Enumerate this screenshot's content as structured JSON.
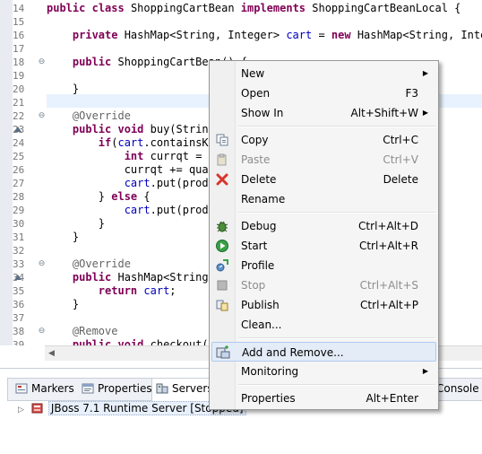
{
  "editor": {
    "lines": [
      {
        "num": "14",
        "segments": [
          {
            "t": "public",
            "k": "kw"
          },
          {
            "t": " "
          },
          {
            "t": "class",
            "k": "kw"
          },
          {
            "t": " ShoppingCartBean "
          },
          {
            "t": "implements",
            "k": "kw"
          },
          {
            "t": " ShoppingCartBeanLocal {"
          }
        ]
      },
      {
        "num": "15",
        "segments": []
      },
      {
        "num": "16",
        "segments": [
          {
            "t": "    "
          },
          {
            "t": "private",
            "k": "kw"
          },
          {
            "t": " HashMap<String, Integer> "
          },
          {
            "t": "cart",
            "k": "fld"
          },
          {
            "t": " = "
          },
          {
            "t": "new",
            "k": "kw"
          },
          {
            "t": " HashMap<String, Intege"
          }
        ]
      },
      {
        "num": "17",
        "segments": []
      },
      {
        "num": "18",
        "segments": [
          {
            "t": "    "
          },
          {
            "t": "public",
            "k": "kw"
          },
          {
            "t": " ShoppingCartBean() {"
          }
        ]
      },
      {
        "num": "19",
        "segments": []
      },
      {
        "num": "20",
        "segments": [
          {
            "t": "    }"
          }
        ]
      },
      {
        "num": "21",
        "segments": []
      },
      {
        "num": "22",
        "segments": [
          {
            "t": "    "
          },
          {
            "t": "@Override",
            "k": "ann"
          }
        ]
      },
      {
        "num": "23",
        "segments": [
          {
            "t": "    "
          },
          {
            "t": "public",
            "k": "kw"
          },
          {
            "t": " "
          },
          {
            "t": "void",
            "k": "kw"
          },
          {
            "t": " buy(String"
          }
        ]
      },
      {
        "num": "24",
        "segments": [
          {
            "t": "        "
          },
          {
            "t": "if",
            "k": "kw"
          },
          {
            "t": "("
          },
          {
            "t": "cart",
            "k": "fld"
          },
          {
            "t": ".containsKe"
          }
        ]
      },
      {
        "num": "25",
        "segments": [
          {
            "t": "            "
          },
          {
            "t": "int",
            "k": "kw"
          },
          {
            "t": " currqt = c"
          }
        ]
      },
      {
        "num": "26",
        "segments": [
          {
            "t": "            currqt += qual"
          }
        ]
      },
      {
        "num": "27",
        "segments": [
          {
            "t": "            "
          },
          {
            "t": "cart",
            "k": "fld"
          },
          {
            "t": ".put(produ"
          }
        ]
      },
      {
        "num": "28",
        "segments": [
          {
            "t": "        } "
          },
          {
            "t": "else",
            "k": "kw"
          },
          {
            "t": " {"
          }
        ]
      },
      {
        "num": "29",
        "segments": [
          {
            "t": "            "
          },
          {
            "t": "cart",
            "k": "fld"
          },
          {
            "t": ".put(produ"
          }
        ]
      },
      {
        "num": "30",
        "segments": [
          {
            "t": "        }"
          }
        ]
      },
      {
        "num": "31",
        "segments": [
          {
            "t": "    }"
          }
        ]
      },
      {
        "num": "32",
        "segments": []
      },
      {
        "num": "33",
        "segments": [
          {
            "t": "    "
          },
          {
            "t": "@Override",
            "k": "ann"
          }
        ]
      },
      {
        "num": "34",
        "segments": [
          {
            "t": "    "
          },
          {
            "t": "public",
            "k": "kw"
          },
          {
            "t": " HashMap<String,"
          }
        ]
      },
      {
        "num": "35",
        "segments": [
          {
            "t": "        "
          },
          {
            "t": "return",
            "k": "kw"
          },
          {
            "t": " "
          },
          {
            "t": "cart",
            "k": "fld"
          },
          {
            "t": ";"
          }
        ]
      },
      {
        "num": "36",
        "segments": [
          {
            "t": "    }"
          }
        ]
      },
      {
        "num": "37",
        "segments": []
      },
      {
        "num": "38",
        "segments": [
          {
            "t": "    "
          },
          {
            "t": "@Remove",
            "k": "ann"
          }
        ]
      },
      {
        "num": "39",
        "segments": [
          {
            "t": "    "
          },
          {
            "t": "public",
            "k": "kw"
          },
          {
            "t": " "
          },
          {
            "t": "void",
            "k": "kw"
          },
          {
            "t": " checkout()"
          }
        ]
      }
    ],
    "fold_markers": [
      "18",
      "22",
      "33",
      "38"
    ],
    "override_markers": [
      "23",
      "34"
    ]
  },
  "views": {
    "tabs": [
      {
        "name": "markers",
        "label": "Markers",
        "icon": "markers-icon"
      },
      {
        "name": "properties",
        "label": "Properties",
        "icon": "properties-icon"
      },
      {
        "name": "servers",
        "label": "Servers",
        "icon": "servers-icon",
        "active": true
      },
      {
        "name": "console",
        "label": "Console",
        "icon": "console-icon"
      }
    ],
    "server_entry": "JBoss 7.1 Runtime Server  [Stopped]"
  },
  "menu": {
    "items": [
      {
        "id": "new",
        "label": "New",
        "shortcut": "",
        "submenu": true,
        "disabled": false,
        "icon": ""
      },
      {
        "id": "open",
        "label": "Open",
        "shortcut": "F3",
        "submenu": false,
        "disabled": false,
        "icon": ""
      },
      {
        "id": "show-in",
        "label": "Show In",
        "shortcut": "Alt+Shift+W",
        "submenu": true,
        "disabled": false,
        "icon": ""
      },
      {
        "sep": true
      },
      {
        "id": "copy",
        "label": "Copy",
        "shortcut": "Ctrl+C",
        "submenu": false,
        "disabled": false,
        "icon": "copy-icon"
      },
      {
        "id": "paste",
        "label": "Paste",
        "shortcut": "Ctrl+V",
        "submenu": false,
        "disabled": true,
        "icon": "paste-icon"
      },
      {
        "id": "delete",
        "label": "Delete",
        "shortcut": "Delete",
        "submenu": false,
        "disabled": false,
        "icon": "delete-icon"
      },
      {
        "id": "rename",
        "label": "Rename",
        "shortcut": "",
        "submenu": false,
        "disabled": false,
        "icon": ""
      },
      {
        "sep": true
      },
      {
        "id": "debug",
        "label": "Debug",
        "shortcut": "Ctrl+Alt+D",
        "submenu": false,
        "disabled": false,
        "icon": "debug-icon"
      },
      {
        "id": "start",
        "label": "Start",
        "shortcut": "Ctrl+Alt+R",
        "submenu": false,
        "disabled": false,
        "icon": "start-icon"
      },
      {
        "id": "profile",
        "label": "Profile",
        "shortcut": "",
        "submenu": false,
        "disabled": false,
        "icon": "profile-icon"
      },
      {
        "id": "stop",
        "label": "Stop",
        "shortcut": "Ctrl+Alt+S",
        "submenu": false,
        "disabled": true,
        "icon": "stop-icon"
      },
      {
        "id": "publish",
        "label": "Publish",
        "shortcut": "Ctrl+Alt+P",
        "submenu": false,
        "disabled": false,
        "icon": "publish-icon"
      },
      {
        "id": "clean",
        "label": "Clean...",
        "shortcut": "",
        "submenu": false,
        "disabled": false,
        "icon": ""
      },
      {
        "sep": true
      },
      {
        "id": "add-and-remove",
        "label": "Add and Remove...",
        "shortcut": "",
        "submenu": false,
        "disabled": false,
        "icon": "add-remove-icon",
        "highlighted": true
      },
      {
        "id": "monitoring",
        "label": "Monitoring",
        "shortcut": "",
        "submenu": true,
        "disabled": false,
        "icon": ""
      },
      {
        "sep": true
      },
      {
        "id": "properties",
        "label": "Properties",
        "shortcut": "Alt+Enter",
        "submenu": false,
        "disabled": false,
        "icon": ""
      }
    ]
  },
  "colors": {
    "keyword": "#7f0055",
    "field": "#0000c0",
    "annotation": "#646464",
    "menu_highlight": "#e4ecf7",
    "disabled_text": "#8d8d8d"
  }
}
